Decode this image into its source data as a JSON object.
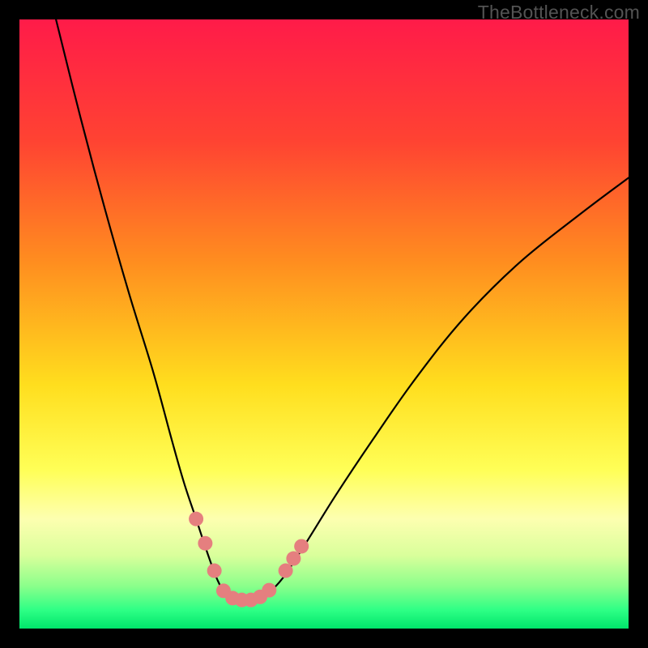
{
  "watermark": "TheBottleneck.com",
  "chart_data": {
    "type": "line",
    "title": "",
    "xlabel": "",
    "ylabel": "",
    "xlim": [
      0,
      100
    ],
    "ylim": [
      0,
      100
    ],
    "background_gradient": {
      "stops": [
        {
          "offset": 0.0,
          "color": "#ff1b49"
        },
        {
          "offset": 0.2,
          "color": "#ff4332"
        },
        {
          "offset": 0.4,
          "color": "#ff8e1f"
        },
        {
          "offset": 0.6,
          "color": "#ffde1e"
        },
        {
          "offset": 0.74,
          "color": "#ffff57"
        },
        {
          "offset": 0.82,
          "color": "#fdffb0"
        },
        {
          "offset": 0.88,
          "color": "#d9ff9b"
        },
        {
          "offset": 0.93,
          "color": "#8bff8b"
        },
        {
          "offset": 0.97,
          "color": "#2dff85"
        },
        {
          "offset": 1.0,
          "color": "#00e56b"
        }
      ]
    },
    "series": [
      {
        "name": "bottleneck-curve",
        "stroke": "#000000",
        "stroke_width": 2.2,
        "x": [
          6,
          10,
          14,
          18,
          22,
          25,
          27,
          29,
          31,
          32.5,
          34,
          36,
          38,
          40,
          43,
          47,
          52,
          58,
          65,
          73,
          82,
          92,
          100
        ],
        "y": [
          100,
          84,
          69,
          55,
          42,
          31,
          24,
          18,
          12,
          8,
          5.5,
          4.7,
          4.7,
          5.3,
          8,
          14,
          22,
          31,
          41,
          51,
          60,
          68,
          74
        ]
      }
    ],
    "markers": {
      "color": "#e57f7f",
      "radius": 9,
      "points": [
        {
          "x": 29.0,
          "y": 18.0
        },
        {
          "x": 30.5,
          "y": 14.0
        },
        {
          "x": 32.0,
          "y": 9.5
        },
        {
          "x": 33.5,
          "y": 6.2
        },
        {
          "x": 35.0,
          "y": 5.0
        },
        {
          "x": 36.5,
          "y": 4.7
        },
        {
          "x": 38.0,
          "y": 4.7
        },
        {
          "x": 39.5,
          "y": 5.2
        },
        {
          "x": 41.0,
          "y": 6.3
        },
        {
          "x": 43.7,
          "y": 9.5
        },
        {
          "x": 45.0,
          "y": 11.5
        },
        {
          "x": 46.3,
          "y": 13.5
        }
      ]
    }
  }
}
